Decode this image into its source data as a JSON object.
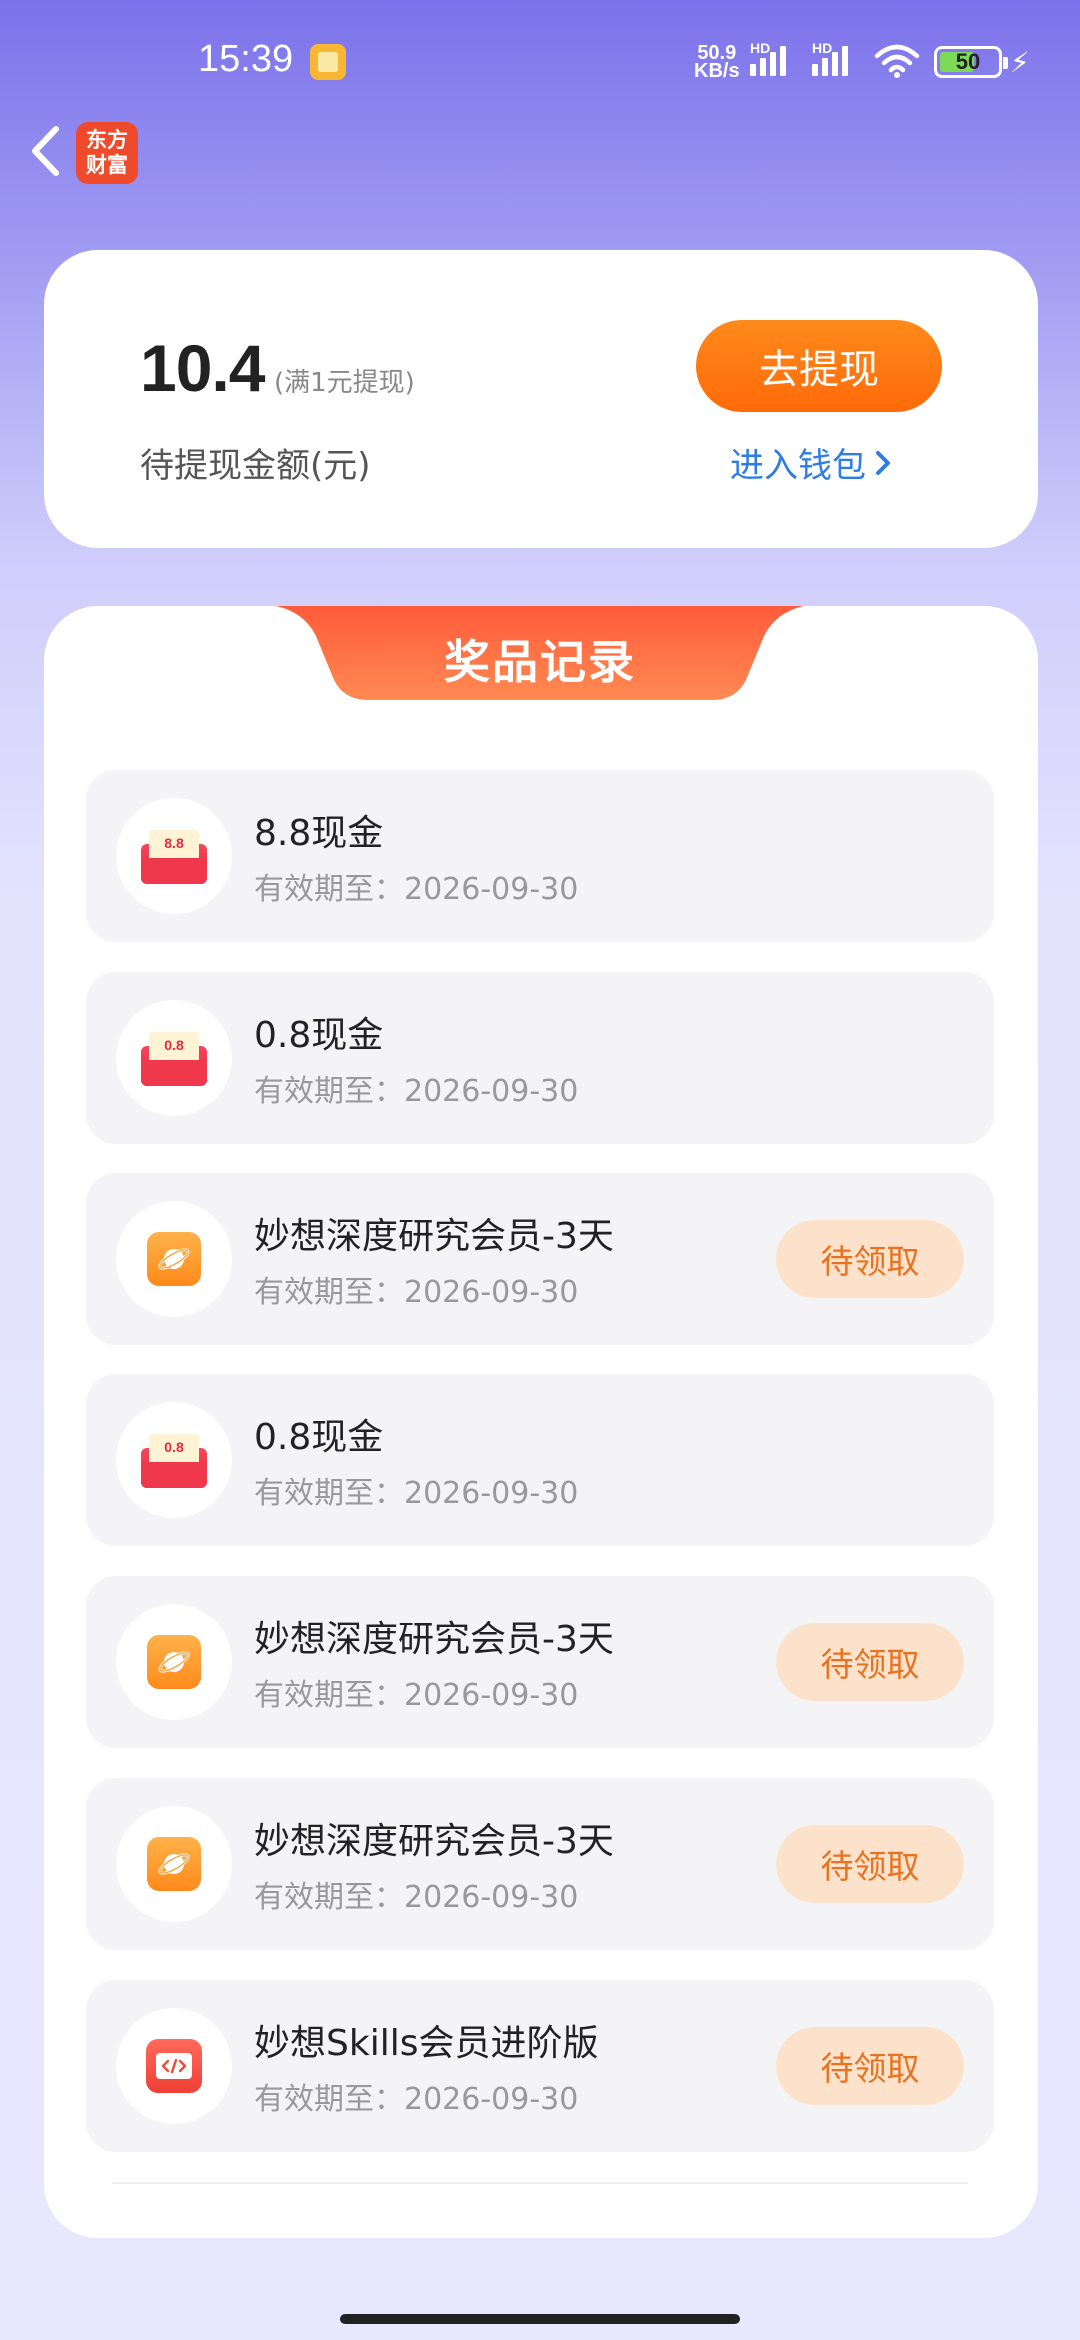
{
  "status_bar": {
    "time": "15:39",
    "net_speed_value": "50.9",
    "net_speed_unit": "KB/s",
    "signal_label_1": "HD",
    "signal_label_2": "HD",
    "battery": "50",
    "icons": [
      "notification-app-icon",
      "signal-icon",
      "signal-icon",
      "wifi-icon",
      "battery-icon",
      "charging-icon"
    ]
  },
  "nav": {
    "back_icon": "chevron-left-icon",
    "logo_line1": "东方",
    "logo_line2": "财富"
  },
  "wallet": {
    "amount": "10.4",
    "amount_note": "(满1元提现)",
    "amount_label": "待提现金额(元)",
    "withdraw_label": "去提现",
    "wallet_link_label": "进入钱包"
  },
  "records": {
    "title": "奖品记录",
    "items": [
      {
        "icon": "red-packet-icon",
        "icon_text": "8.8",
        "title": "8.8现金",
        "expiry": "有效期至：2026-09-30"
      },
      {
        "icon": "red-packet-icon",
        "icon_text": "0.8",
        "title": "0.8现金",
        "expiry": "有效期至：2026-09-30"
      },
      {
        "icon": "planet-icon",
        "title": "妙想深度研究会员-3天",
        "expiry": "有效期至：2026-09-30",
        "action": "待领取"
      },
      {
        "icon": "red-packet-icon",
        "icon_text": "0.8",
        "title": "0.8现金",
        "expiry": "有效期至：2026-09-30"
      },
      {
        "icon": "planet-icon",
        "title": "妙想深度研究会员-3天",
        "expiry": "有效期至：2026-09-30",
        "action": "待领取"
      },
      {
        "icon": "planet-icon",
        "title": "妙想深度研究会员-3天",
        "expiry": "有效期至：2026-09-30",
        "action": "待领取"
      },
      {
        "icon": "code-icon",
        "title": "妙想Skills会员进阶版",
        "expiry": "有效期至：2026-09-30",
        "action": "待领取"
      }
    ]
  },
  "colors": {
    "accent_orange": "#ff7a10",
    "link_blue": "#2d7de5",
    "claim_bg": "#fde2cb",
    "claim_text": "#e8721f",
    "tab_red": "#f5533a"
  }
}
